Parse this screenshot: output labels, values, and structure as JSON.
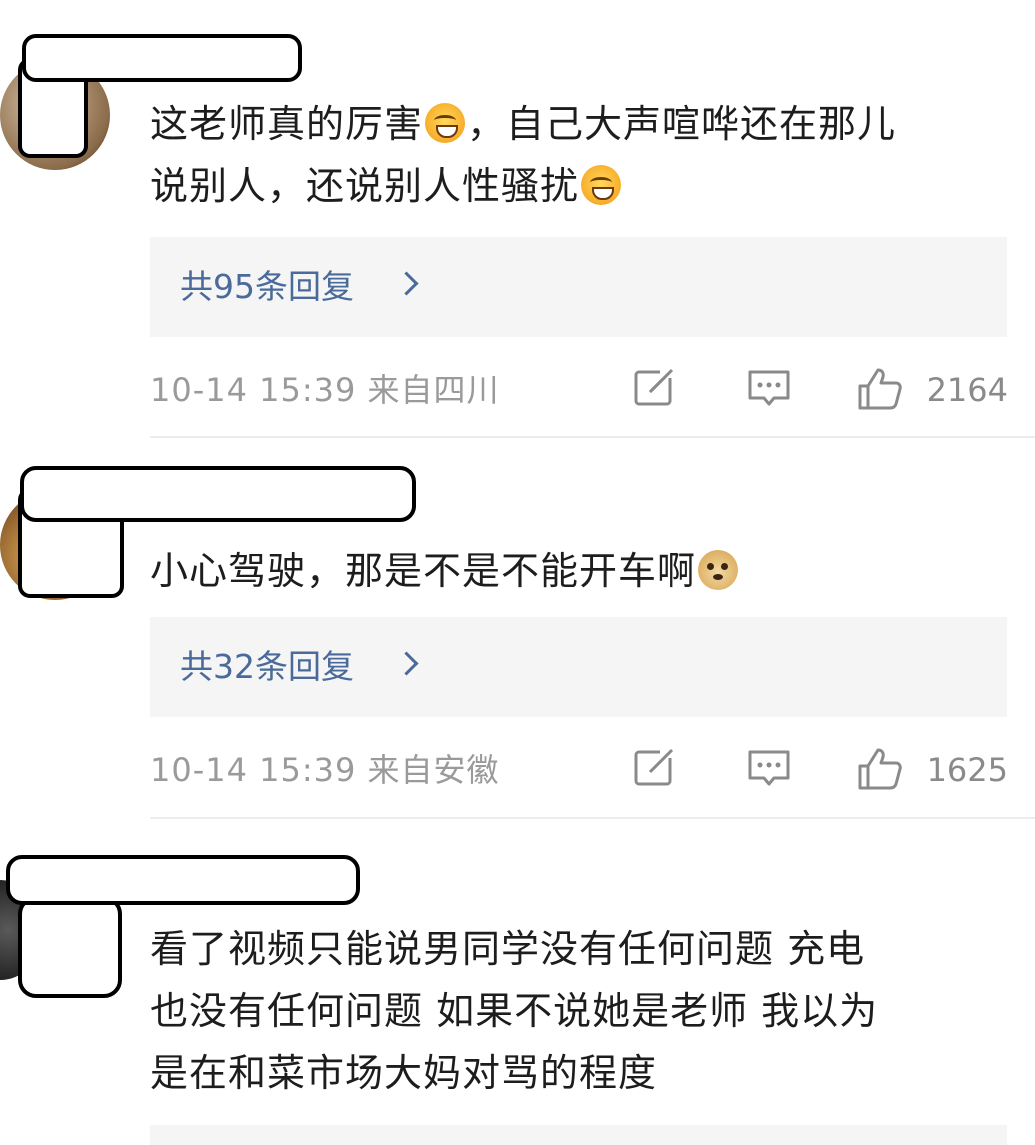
{
  "comments": [
    {
      "text_parts": [
        "这老师真的厉害",
        "，自己大声喧哗还在那儿\n说别人，还说别人性骚扰",
        ""
      ],
      "emojis": [
        "grin-emoji",
        "grin-emoji"
      ],
      "replies_label": "共95条回复",
      "timestamp": "10-14 15:39",
      "location": "来自四川",
      "likes": "2164"
    },
    {
      "text_parts": [
        "小心驾驶，那是不是不能开车啊"
      ],
      "emojis": [
        "doge-emoji"
      ],
      "replies_label": "共32条回复",
      "timestamp": "10-14 15:39",
      "location": "来自安徽",
      "likes": "1625"
    },
    {
      "text_parts": [
        "看了视频只能说男同学没有任何问题 充电\n也没有任何问题 如果不说她是老师 我以为\n是在和菜市场大妈对骂的程度"
      ]
    }
  ],
  "icons": {
    "share": "share-edit-icon",
    "comment": "comment-bubble-icon",
    "like": "thumbs-up-icon",
    "chevron": "chevron-right-icon"
  },
  "colors": {
    "reply_link": "#4a6a9a",
    "meta_text": "#9a9a9a",
    "reply_bg": "#f5f5f5"
  }
}
